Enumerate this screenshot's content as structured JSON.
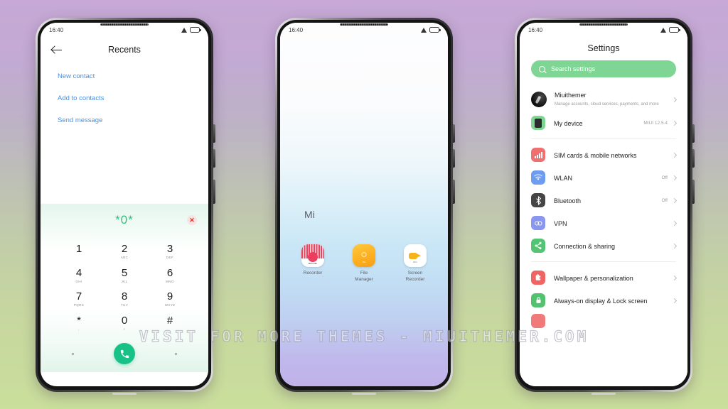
{
  "background": {
    "top_color": "#c7a8d6",
    "bottom_color": "#cadf9c"
  },
  "watermark": {
    "text": "VISIT FOR MORE THEMES - MIUITHEMER.COM"
  },
  "phone1": {
    "status_bar": {
      "time": "16:40",
      "signal_icon": "signal-triangle-icon",
      "battery_icon": "battery-icon"
    },
    "header": {
      "back_icon": "back-arrow-icon",
      "title": "Recents"
    },
    "links": [
      {
        "label": "New contact"
      },
      {
        "label": "Add to contacts"
      },
      {
        "label": "Send message"
      }
    ],
    "dialer": {
      "number": "*0*",
      "clear_icon": "clear-x-icon",
      "keys": [
        {
          "digit": "1",
          "letters": ""
        },
        {
          "digit": "2",
          "letters": "ABC"
        },
        {
          "digit": "3",
          "letters": "DEF"
        },
        {
          "digit": "4",
          "letters": "GHI"
        },
        {
          "digit": "5",
          "letters": "JKL"
        },
        {
          "digit": "6",
          "letters": "MNO"
        },
        {
          "digit": "7",
          "letters": "PQRS"
        },
        {
          "digit": "8",
          "letters": "TUV"
        },
        {
          "digit": "9",
          "letters": "WXYZ"
        },
        {
          "digit": "*",
          "letters": ","
        },
        {
          "digit": "0",
          "letters": "+"
        },
        {
          "digit": "#",
          "letters": ""
        }
      ],
      "call_icon": "phone-call-icon",
      "call_color": "#17c187"
    }
  },
  "phone2": {
    "status_bar": {
      "time": "16:40",
      "signal_icon": "signal-triangle-icon",
      "battery_icon": "battery-icon"
    },
    "folder_label": "Mi",
    "apps": [
      {
        "label": "Recorder",
        "icon": "recorder-icon",
        "icon_text": "Recorder"
      },
      {
        "label": "File\nManager",
        "label_line1": "File",
        "label_line2": "Manager",
        "icon": "file-manager-icon",
        "icon_text": "File"
      },
      {
        "label": "Screen\nRecorder",
        "label_line1": "Screen",
        "label_line2": "Recorder",
        "icon": "screen-recorder-icon",
        "icon_text": "REC"
      }
    ]
  },
  "phone3": {
    "status_bar": {
      "time": "16:40",
      "signal_icon": "signal-triangle-icon",
      "battery_icon": "battery-icon"
    },
    "title": "Settings",
    "search": {
      "placeholder": "Search settings",
      "icon": "search-icon",
      "color": "#7fd694"
    },
    "account": {
      "name": "Miuithemer",
      "subtitle": "Manage accounts, cloud services, payments, and more",
      "avatar_icon": "account-avatar"
    },
    "device": {
      "label": "My device",
      "value": "MIUI 12.5.4",
      "icon": "device-phone-icon"
    },
    "items": [
      {
        "label": "SIM cards & mobile networks",
        "value": "",
        "icon": "sim-signal-icon"
      },
      {
        "label": "WLAN",
        "value": "Off",
        "icon": "wifi-icon"
      },
      {
        "label": "Bluetooth",
        "value": "Off",
        "icon": "bluetooth-icon"
      },
      {
        "label": "VPN",
        "value": "",
        "icon": "vpn-icon"
      },
      {
        "label": "Connection & sharing",
        "value": "",
        "icon": "share-icon"
      }
    ],
    "personalization": [
      {
        "label": "Wallpaper & personalization",
        "value": "",
        "icon": "wallpaper-icon"
      },
      {
        "label": "Always-on display & Lock screen",
        "value": "",
        "icon": "lock-icon"
      }
    ]
  }
}
